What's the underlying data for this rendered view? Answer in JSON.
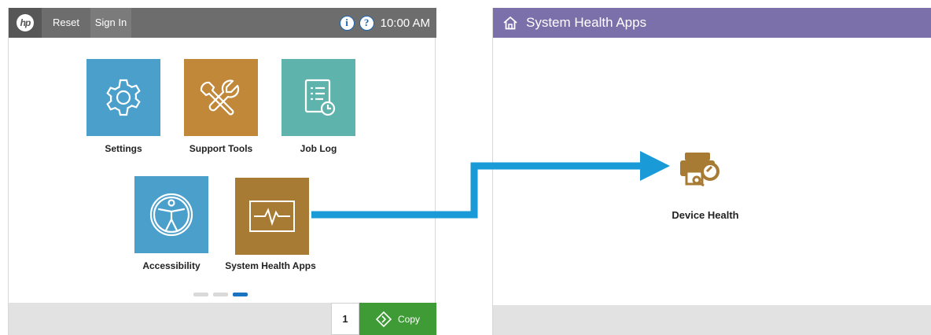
{
  "left_screen": {
    "topbar": {
      "logo_text": "hp",
      "reset_label": "Reset",
      "signin_label": "Sign In",
      "info_icon": "i",
      "help_icon": "?",
      "time": "10:00 AM"
    },
    "tiles": [
      {
        "label": "Settings",
        "icon": "gear-icon",
        "color": "#4a9fcb"
      },
      {
        "label": "Support Tools",
        "icon": "tools-icon",
        "color": "#c1883a"
      },
      {
        "label": "Job Log",
        "icon": "job-log-icon",
        "color": "#5fb3ad"
      },
      {
        "label": "Accessibility",
        "icon": "accessibility-icon",
        "color": "#4a9fcb"
      },
      {
        "label": "System Health Apps",
        "icon": "health-pulse-icon",
        "color": "#a87b35"
      }
    ],
    "page_indicator": {
      "pages": 3,
      "active": 3
    },
    "copy_quantity": "1",
    "copy_label": "Copy"
  },
  "right_screen": {
    "header_title": "System Health Apps",
    "app_label": "Device Health",
    "header_color": "#7b70a9",
    "icon_color": "#a87b35"
  },
  "arrow_color": "#1a9ad7"
}
